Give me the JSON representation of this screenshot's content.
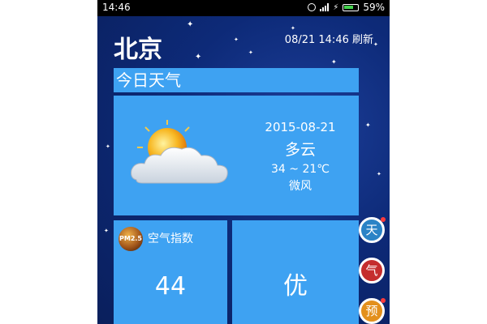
{
  "status_bar": {
    "time": "14:46",
    "battery": "59%",
    "icons": [
      "alarm-icon",
      "signal-icon",
      "charging-icon",
      "battery-icon"
    ]
  },
  "header": {
    "city": "北京",
    "updated": "08/21 14:46 刷新"
  },
  "today": {
    "title": "今日天气",
    "date": "2015-08-21",
    "condition": "多云",
    "temperature": "34 ~ 21℃",
    "wind": "微风",
    "icon": "partly-cloudy-icon"
  },
  "air": {
    "icon_label": "PM2.5",
    "title": "空气指数",
    "value": "44",
    "quality": "优"
  },
  "side_buttons": [
    {
      "label": "天",
      "color": "#2a83c6"
    },
    {
      "label": "气",
      "color": "#c52d2d"
    },
    {
      "label": "预",
      "color": "#e3901c"
    }
  ]
}
